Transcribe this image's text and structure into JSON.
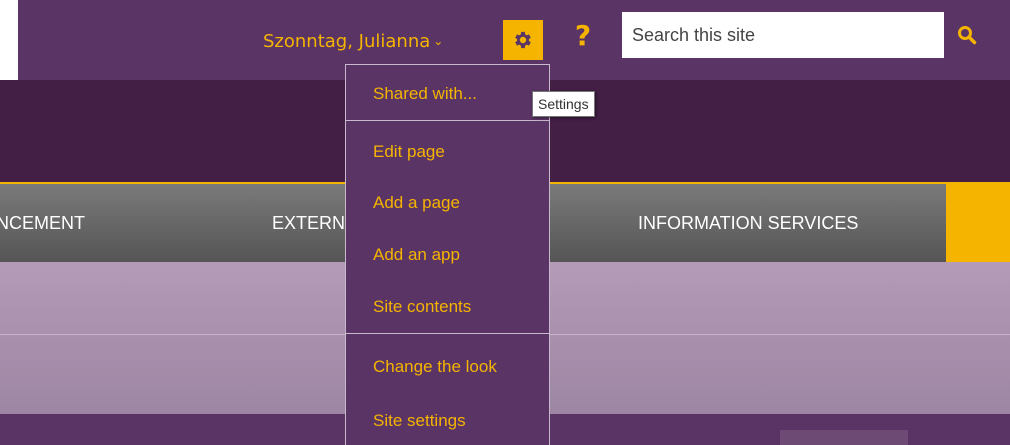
{
  "suite_bar": {
    "user_name": "Szonntag, Julianna",
    "user_menu_chevron": "⌄",
    "help_label": "?",
    "search_placeholder": "Search this site"
  },
  "nav": {
    "items": [
      {
        "label": "NCEMENT"
      },
      {
        "label": "EXTERN"
      },
      {
        "label": "INFORMATION SERVICES"
      }
    ]
  },
  "settings_menu": {
    "tooltip": "Settings",
    "items": [
      {
        "label": "Shared with..."
      },
      {
        "label": "Edit page"
      },
      {
        "label": "Add a page"
      },
      {
        "label": "Add an app"
      },
      {
        "label": "Site contents"
      },
      {
        "label": "Change the look"
      },
      {
        "label": "Site settings"
      }
    ]
  },
  "icons": {
    "settings": "gear-icon",
    "help": "question-icon",
    "search": "magnifier-icon",
    "user_menu": "chevron-down-icon"
  },
  "colors": {
    "accent": "#f5b400",
    "suite_bar": "#5a3464",
    "header": "#431e45",
    "nav": "#666666",
    "band": "#a88fae"
  }
}
